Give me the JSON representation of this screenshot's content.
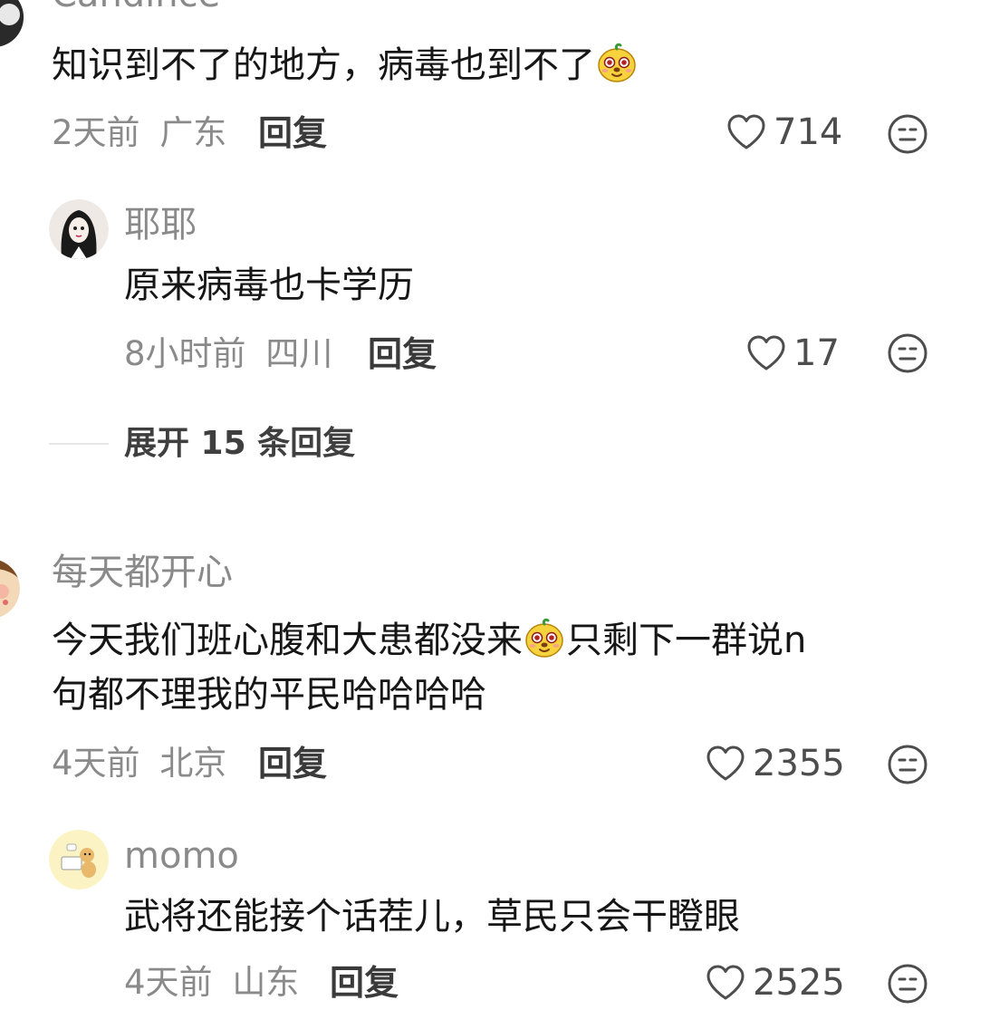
{
  "thread1": {
    "username": "Candince",
    "text": "知识到不了的地方，病毒也到不了",
    "time": "2天前",
    "location": "广东",
    "reply_label": "回复",
    "likes": "714"
  },
  "reply1": {
    "username": "耶耶",
    "text": "原来病毒也卡学历",
    "time": "8小时前",
    "location": "四川",
    "reply_label": "回复",
    "likes": "17"
  },
  "expand": {
    "label": "展开 15 条回复"
  },
  "thread2": {
    "username": "每天都开心",
    "text_line1_a": "今天我们班心腹和大患都没来",
    "text_line1_b": "只剩下一群说n",
    "text_line2": "句都不理我的平民哈哈哈哈",
    "time": "4天前",
    "location": "北京",
    "reply_label": "回复",
    "likes": "2355"
  },
  "reply2": {
    "username": "momo",
    "text": "武将还能接个话茬儿，草民只会干瞪眼",
    "time": "4天前",
    "location": "山东",
    "reply_label": "回复",
    "likes": "2525"
  },
  "icons": {
    "like": "heart-outline-icon",
    "dislike": "neutral-face-icon",
    "emoji": "yellow-doge-emoji"
  },
  "colors": {
    "primary_text": "#161616",
    "secondary_text": "#8a8a8a",
    "reply_text": "#3a3a3a",
    "emoji_yellow": "#f6d23c"
  }
}
